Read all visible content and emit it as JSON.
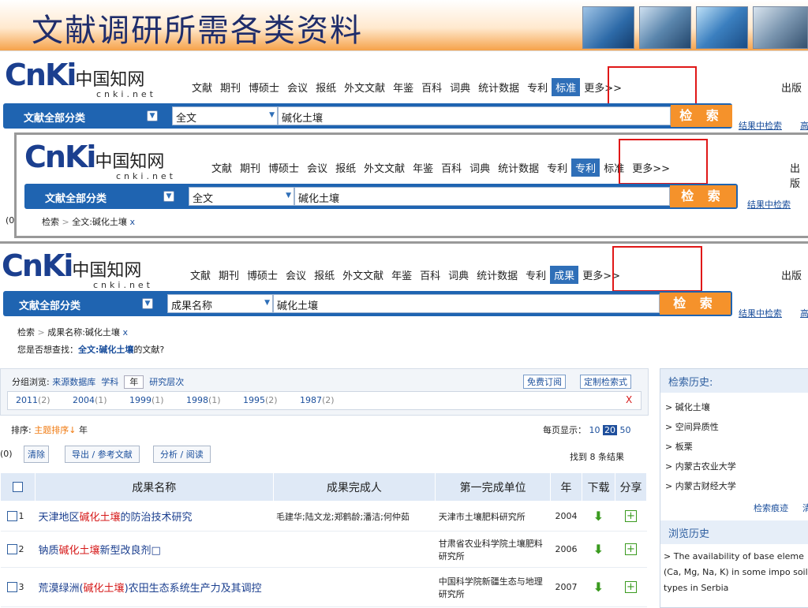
{
  "slide": {
    "title": "文献调研所需各类资料"
  },
  "cnki": {
    "logo_big": "CnKi",
    "logo_cn": "中国知网",
    "logo_sub": "cnki.net",
    "nav": [
      "文献",
      "期刊",
      "博硕士",
      "会议",
      "报纸",
      "外文文献",
      "年鉴",
      "百科",
      "词典",
      "统计数据",
      "专利"
    ],
    "more": "更多>>",
    "publish": "出版",
    "category": "文献全部分类",
    "keyword": "碱化土壤",
    "search_button": "检 索",
    "refine": "结果中检索",
    "adv": "高"
  },
  "panel1": {
    "active_tab": "标准",
    "field": "全文"
  },
  "panel2": {
    "active_tab": "专利",
    "extra_tab": "标准",
    "field": "全文",
    "crumb_a": "检索",
    "crumb_b": "全文:碱化土壤",
    "crumb_x": "x",
    "left_mark": "(0"
  },
  "panel3": {
    "active_tab": "成果",
    "field": "成果名称",
    "crumb_a": "检索",
    "crumb_b": "成果名称:碱化土壤",
    "crumb_x": "x",
    "suggest_prefix": "您是否想查找：",
    "suggest_link": "全文:碱化土壤",
    "suggest_suffix": "的文献?"
  },
  "browse": {
    "label": "分组浏览:",
    "options": [
      "来源数据库",
      "学科"
    ],
    "active": "年",
    "option_last": "研究层次",
    "free_sub": "免费订阅",
    "custom": "定制检索式",
    "years": [
      {
        "year": "2011",
        "count": "(2)"
      },
      {
        "year": "2004",
        "count": "(1)"
      },
      {
        "year": "1999",
        "count": "(1)"
      },
      {
        "year": "1998",
        "count": "(1)"
      },
      {
        "year": "1995",
        "count": "(2)"
      },
      {
        "year": "1987",
        "count": "(2)"
      }
    ],
    "close": "X"
  },
  "sort": {
    "label": "排序:",
    "active": "主题排序",
    "other": "年",
    "per_page_label": "每页显示：",
    "per_page": [
      "10",
      "20",
      "50"
    ],
    "per_page_active": "20",
    "found": "找到 8 条结果"
  },
  "actions": {
    "left_mark": "(0)",
    "clear": "清除",
    "export": "导出 / 参考文献",
    "analyze": "分析 / 阅读"
  },
  "table": {
    "headers": [
      "成果名称",
      "成果完成人",
      "第一完成单位",
      "年",
      "下载",
      "分享"
    ],
    "rows": [
      {
        "num": "1",
        "pre": "天津地区",
        "hl": "碱化土壤",
        "post": "的防治技术研究",
        "people": "毛建华;陆文龙;郑鹤龄;潘洁;何仲茹",
        "unit": "天津市土壤肥料研究所",
        "year": "2004"
      },
      {
        "num": "2",
        "pre": "钠质",
        "hl": "碱化土壤",
        "post": "新型改良剂□",
        "people": "",
        "unit": "甘肃省农业科学院土壤肥料研究所",
        "year": "2006"
      },
      {
        "num": "3",
        "pre": "荒漠绿洲(",
        "hl": "碱化土壤",
        "post": ")农田生态系统生产力及其调控",
        "people": "",
        "unit": "中国科学院新疆生态与地理研究所",
        "year": "2007"
      }
    ]
  },
  "sidebar": {
    "history_title": "检索历史:",
    "history": [
      "碱化土壤",
      "空间异质性",
      "板栗",
      "内蒙古农业大学",
      "内蒙古财经大学"
    ],
    "trace": "检索痕迹",
    "trace2": "清",
    "browse_title": "浏览历史",
    "browse_item": "The availability of base eleme (Ca, Mg, Na, K) in some impo soil types in Serbia"
  },
  "colors": {
    "brand": "#1f64b1",
    "search_btn": "#f5922b",
    "highlight": "#e01818"
  }
}
